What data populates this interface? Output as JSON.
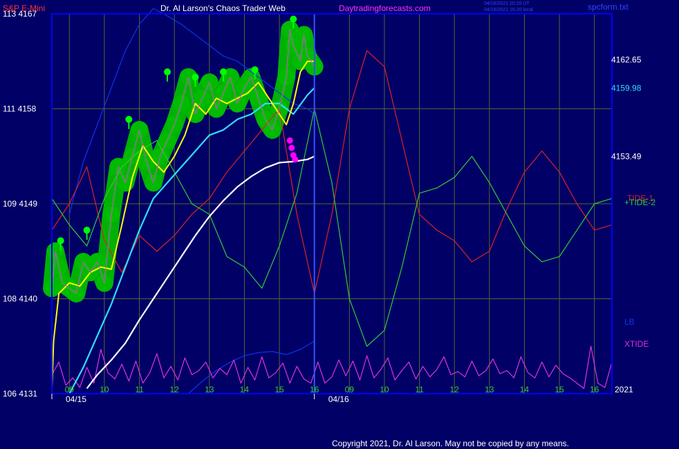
{
  "header": {
    "symbol": "S&P E-Mini",
    "site_title": "Dr. Al Larson's Chaos Trader Web",
    "site_url": "Daytradingforecasts.com",
    "stamp_line1": "04/16/2021 20:20 UT",
    "stamp_line2": "04/16/2021 16:20 local",
    "filename": "spcform.txt"
  },
  "footer": {
    "copyright": "Copyright 2021, Dr. Al Larson. May not be copied by any means."
  },
  "colors": {
    "background": "#000066",
    "frame": "#0000ff",
    "grid": "#556633",
    "price": "#00ff00",
    "price_glow": "#00bb00",
    "yellow_ma": "#ffff00",
    "cyan_ma": "#33ddff",
    "white_ma": "#ffffff",
    "tide1": "#dd2222",
    "tide2": "#33cc33",
    "lb": "#1133ee",
    "xtide": "#dd33dd",
    "magenta_marker": "#ff00ff",
    "symbol_label": "#ff3333",
    "title_label": "#ffffff",
    "url_label": "#ff33ff",
    "axis_label": "#ffffff"
  },
  "chart_data": {
    "type": "line",
    "y_axis_left": {
      "ticks": [
        {
          "hi": "113",
          "lo": "4167",
          "value": 4167
        },
        {
          "hi": "111",
          "lo": "4158",
          "value": 4158
        },
        {
          "hi": "109",
          "lo": "4149",
          "value": 4149
        },
        {
          "hi": "108",
          "lo": "4140",
          "value": 4140
        },
        {
          "hi": "106",
          "lo": "4131",
          "value": 4131
        }
      ],
      "ylim": [
        4131,
        4167
      ]
    },
    "y_axis_right": {
      "price_labels": [
        {
          "text": "4162.65",
          "value": 4162.65,
          "color": "#ffffff"
        },
        {
          "text": "4159.98",
          "value": 4159.98,
          "color": "#33ddff"
        },
        {
          "text": "4153.49",
          "value": 4153.49,
          "color": "#ffffff"
        }
      ],
      "legend": [
        {
          "text": "TIDE-1",
          "color": "#dd2222"
        },
        {
          "text": "+TIDE-2",
          "color": "#33cc33"
        },
        {
          "text": "LB",
          "color": "#1133ee"
        },
        {
          "text": "XTIDE",
          "color": "#dd33dd"
        }
      ]
    },
    "x_axis": {
      "hour_labels": [
        "09",
        "10",
        "11",
        "12",
        "13",
        "14",
        "15",
        "16",
        "09",
        "10",
        "11",
        "12",
        "13",
        "14",
        "15",
        "16"
      ],
      "date_labels": [
        "04/15",
        "04/16"
      ],
      "year_label": "2021",
      "xlim": [
        8.5,
        24.5
      ]
    },
    "series": [
      {
        "id": "price",
        "x": [
          8.5,
          8.6,
          8.7,
          8.8,
          9.0,
          9.2,
          9.4,
          9.6,
          9.8,
          10.0,
          10.2,
          10.4,
          10.6,
          10.8,
          11.0,
          11.2,
          11.4,
          11.6,
          11.8,
          12.0,
          12.2,
          12.4,
          12.6,
          12.8,
          13.0,
          13.2,
          13.4,
          13.6,
          13.8,
          14.0,
          14.2,
          14.4,
          14.6,
          14.8,
          15.0,
          15.2,
          15.3,
          15.4,
          15.6,
          15.7,
          15.8,
          16.0
        ],
        "values": [
          4141.0,
          4144.5,
          4143.0,
          4141.5,
          4141.0,
          4140.5,
          4143.5,
          4142.5,
          4143.5,
          4141.5,
          4148.0,
          4152.5,
          4151.0,
          4153.5,
          4156.0,
          4153.0,
          4151.0,
          4153.5,
          4155.0,
          4156.5,
          4158.5,
          4161.0,
          4157.5,
          4159.0,
          4160.5,
          4158.0,
          4159.5,
          4161.0,
          4158.5,
          4160.0,
          4161.0,
          4159.0,
          4157.0,
          4156.0,
          4158.0,
          4161.0,
          4165.5,
          4164.0,
          4162.5,
          4165.0,
          4163.0,
          4162.0
        ]
      },
      {
        "id": "yellow_ma",
        "x": [
          8.5,
          8.55,
          8.7,
          9.0,
          9.3,
          9.6,
          9.9,
          10.2,
          10.5,
          10.8,
          11.1,
          11.4,
          11.7,
          12.0,
          12.3,
          12.6,
          12.9,
          13.2,
          13.5,
          13.8,
          14.1,
          14.4,
          14.7,
          15.0,
          15.2,
          15.4,
          15.6,
          15.8,
          16.0
        ],
        "values": [
          4131.5,
          4136.0,
          4140.5,
          4141.5,
          4141.2,
          4142.5,
          4143.0,
          4142.8,
          4147.0,
          4151.5,
          4154.5,
          4153.0,
          4152.0,
          4153.5,
          4155.5,
          4158.5,
          4157.5,
          4159.0,
          4158.5,
          4159.0,
          4159.5,
          4160.5,
          4159.0,
          4157.5,
          4156.5,
          4158.5,
          4161.5,
          4162.5,
          4162.5
        ]
      },
      {
        "id": "cyan_ma",
        "x": [
          9.0,
          9.4,
          9.8,
          10.2,
          10.6,
          11.0,
          11.4,
          11.8,
          12.2,
          12.6,
          13.0,
          13.4,
          13.8,
          14.2,
          14.6,
          15.0,
          15.4,
          15.8,
          16.0
        ],
        "values": [
          4131.0,
          4133.5,
          4136.5,
          4139.5,
          4143.0,
          4146.5,
          4149.5,
          4151.0,
          4152.5,
          4154.0,
          4155.5,
          4156.0,
          4157.0,
          4157.5,
          4158.5,
          4158.5,
          4157.5,
          4159.3,
          4159.98
        ]
      },
      {
        "id": "white_ma",
        "x": [
          9.5,
          9.8,
          10.2,
          10.6,
          11.0,
          11.4,
          11.8,
          12.2,
          12.6,
          13.0,
          13.4,
          13.8,
          14.2,
          14.6,
          15.0,
          15.4,
          15.8,
          16.0
        ],
        "values": [
          4131.5,
          4132.8,
          4134.2,
          4135.8,
          4138.0,
          4140.0,
          4142.0,
          4144.0,
          4146.0,
          4147.8,
          4149.3,
          4150.6,
          4151.6,
          4152.4,
          4152.9,
          4153.0,
          4153.2,
          4153.49
        ]
      },
      {
        "id": "tide1",
        "x": [
          8.5,
          9.0,
          9.5,
          10.0,
          10.5,
          11.0,
          11.5,
          12.0,
          12.5,
          13.0,
          13.5,
          14.0,
          14.5,
          15.0,
          15.5,
          16.0,
          16.5,
          17.0,
          17.5,
          18.0,
          18.5,
          19.0,
          19.5,
          20.0,
          20.5,
          21.0,
          21.5,
          22.0,
          22.5,
          23.0,
          23.5,
          24.0,
          24.5
        ],
        "values": [
          4146.5,
          4149.0,
          4152.5,
          4145.5,
          4142.5,
          4146.0,
          4144.5,
          4146.0,
          4148.0,
          4149.5,
          4152.0,
          4154.0,
          4156.0,
          4158.0,
          4148.0,
          4140.5,
          4148.0,
          4158.0,
          4163.5,
          4162.0,
          4155.0,
          4148.0,
          4146.5,
          4145.5,
          4143.5,
          4144.5,
          4148.5,
          4152.0,
          4154.0,
          4152.0,
          4149.0,
          4146.5,
          4147.0
        ]
      },
      {
        "id": "tide2",
        "x": [
          8.5,
          9.0,
          9.5,
          10.0,
          10.5,
          11.0,
          11.5,
          12.0,
          12.5,
          13.0,
          13.5,
          14.0,
          14.5,
          15.0,
          15.5,
          16.0,
          16.5,
          17.0,
          17.5,
          18.0,
          18.5,
          19.0,
          19.5,
          20.0,
          20.5,
          21.0,
          21.5,
          22.0,
          22.5,
          23.0,
          23.5,
          24.0,
          24.5
        ],
        "values": [
          4149.5,
          4147.0,
          4145.0,
          4149.5,
          4152.5,
          4154.0,
          4155.0,
          4152.0,
          4149.0,
          4148.0,
          4144.0,
          4143.0,
          4141.0,
          4145.0,
          4150.0,
          4158.0,
          4151.0,
          4140.0,
          4135.5,
          4137.0,
          4143.0,
          4150.0,
          4150.5,
          4151.5,
          4153.5,
          4151.0,
          4148.0,
          4145.0,
          4143.5,
          4144.0,
          4146.5,
          4149.0,
          4149.5
        ]
      },
      {
        "id": "lb",
        "x": [
          9.0,
          9.4,
          9.8,
          10.2,
          10.6,
          11.0,
          11.4,
          11.8,
          12.2,
          12.6,
          13.0,
          13.4,
          13.8,
          14.2,
          14.6,
          15.0,
          15.4,
          15.8,
          16.0
        ],
        "values": [
          4148.0,
          4153.0,
          4156.5,
          4160.0,
          4163.5,
          4166.0,
          4167.5,
          4166.8,
          4166.0,
          4165.0,
          4164.0,
          4163.0,
          4162.5,
          4161.5,
          4160.5,
          4159.5,
          4158.5,
          4158.0,
          4157.5
        ]
      },
      {
        "id": "lb_lower",
        "x": [
          12.4,
          12.8,
          13.2,
          13.6,
          14.0,
          14.4,
          14.8,
          15.2,
          15.6,
          16.0
        ],
        "values": [
          4131.0,
          4132.2,
          4133.2,
          4134.0,
          4134.6,
          4134.9,
          4135.0,
          4134.7,
          4135.2,
          4136.0
        ]
      },
      {
        "id": "xtide",
        "x": [
          8.5,
          8.7,
          8.9,
          9.1,
          9.3,
          9.5,
          9.7,
          9.9,
          10.1,
          10.3,
          10.5,
          10.7,
          10.9,
          11.1,
          11.3,
          11.5,
          11.7,
          11.9,
          12.1,
          12.3,
          12.5,
          12.7,
          12.9,
          13.1,
          13.3,
          13.5,
          13.7,
          13.9,
          14.1,
          14.3,
          14.5,
          14.7,
          14.9,
          15.1,
          15.3,
          15.5,
          15.7,
          15.9,
          16.1,
          16.3,
          16.5,
          16.7,
          16.9,
          17.1,
          17.3,
          17.5,
          17.7,
          17.9,
          18.1,
          18.3,
          18.5,
          18.7,
          18.9,
          19.1,
          19.3,
          19.5,
          19.7,
          19.9,
          20.1,
          20.3,
          20.5,
          20.7,
          20.9,
          21.1,
          21.3,
          21.5,
          21.7,
          21.9,
          22.1,
          22.3,
          22.5,
          22.7,
          22.9,
          23.1,
          23.3,
          23.5,
          23.7,
          23.9,
          24.1,
          24.3,
          24.5
        ],
        "values": [
          4132.8,
          4134.0,
          4131.8,
          4132.5,
          4131.6,
          4133.5,
          4132.0,
          4135.2,
          4133.0,
          4132.4,
          4133.8,
          4132.2,
          4134.1,
          4132.0,
          4133.0,
          4134.8,
          4132.5,
          4133.6,
          4132.3,
          4134.4,
          4132.8,
          4133.2,
          4134.0,
          4132.5,
          4133.4,
          4132.8,
          4134.2,
          4132.0,
          4133.5,
          4132.3,
          4134.5,
          4132.5,
          4133.0,
          4133.9,
          4132.0,
          4133.6,
          4132.4,
          4132.0,
          4134.0,
          4132.0,
          4132.6,
          4134.2,
          4132.7,
          4134.1,
          4132.3,
          4134.6,
          4132.5,
          4133.3,
          4134.4,
          4132.3,
          4133.2,
          4134.0,
          4132.4,
          4133.6,
          4132.6,
          4133.3,
          4134.5,
          4132.8,
          4133.1,
          4132.6,
          4134.1,
          4132.7,
          4133.2,
          4134.3,
          4132.9,
          4133.2,
          4132.5,
          4134.5,
          4133.0,
          4132.5,
          4134.0,
          4132.6,
          4133.7,
          4132.9,
          4132.5,
          4132.0,
          4131.5,
          4135.5,
          4132.0,
          4131.6,
          4134.0
        ]
      }
    ],
    "peak_markers": {
      "x": [
        8.75,
        9.5,
        10.7,
        11.8,
        12.6,
        13.4,
        14.3,
        15.4
      ],
      "values": [
        4145.5,
        4146.5,
        4157.0,
        4161.5,
        4161.0,
        4161.5,
        4161.7,
        4166.5
      ]
    },
    "magenta_markers": {
      "x": [
        15.3,
        15.35,
        15.4,
        15.45
      ],
      "values": [
        4155.0,
        4154.3,
        4153.6,
        4153.2
      ]
    },
    "vertical_marker_x": 16.0
  }
}
